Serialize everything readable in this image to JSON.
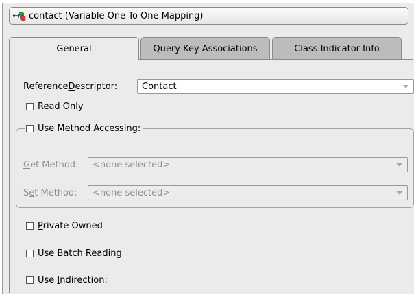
{
  "title": {
    "text": "contact (Variable One To One Mapping)",
    "icon": "variable-one-to-one-mapping-icon"
  },
  "tabs": [
    {
      "label": "General",
      "active": true
    },
    {
      "label": "Query Key Associations",
      "active": false
    },
    {
      "label": "Class Indicator Info",
      "active": false
    }
  ],
  "general": {
    "reference_descriptor": {
      "pre": "Reference ",
      "mnemonic": "D",
      "post": "escriptor:",
      "value": "Contact"
    },
    "read_only": {
      "pre": "",
      "mnemonic": "R",
      "post": "ead Only",
      "checked": false
    },
    "use_method_accessing": {
      "pre": "Use ",
      "mnemonic": "M",
      "post": "ethod Accessing:",
      "checked": false
    },
    "get_method": {
      "pre": "",
      "mnemonic": "G",
      "post": "et Method:",
      "value": "<none selected>"
    },
    "set_method": {
      "pre": "S",
      "mnemonic": "e",
      "post": "t Method:",
      "value": "<none selected>"
    },
    "private_owned": {
      "pre": "",
      "mnemonic": "P",
      "post": "rivate Owned",
      "checked": false
    },
    "use_batch_reading": {
      "pre": "Use ",
      "mnemonic": "B",
      "post": "atch Reading",
      "checked": false
    },
    "use_indirection": {
      "pre": "Use ",
      "mnemonic": "I",
      "post": "ndirection:",
      "checked": false
    }
  },
  "colors": {
    "panel": "#ebebeb",
    "inactive_tab": "#bcbcbc",
    "border": "#8a8a8a",
    "disabled_text": "#8e8e8e"
  }
}
